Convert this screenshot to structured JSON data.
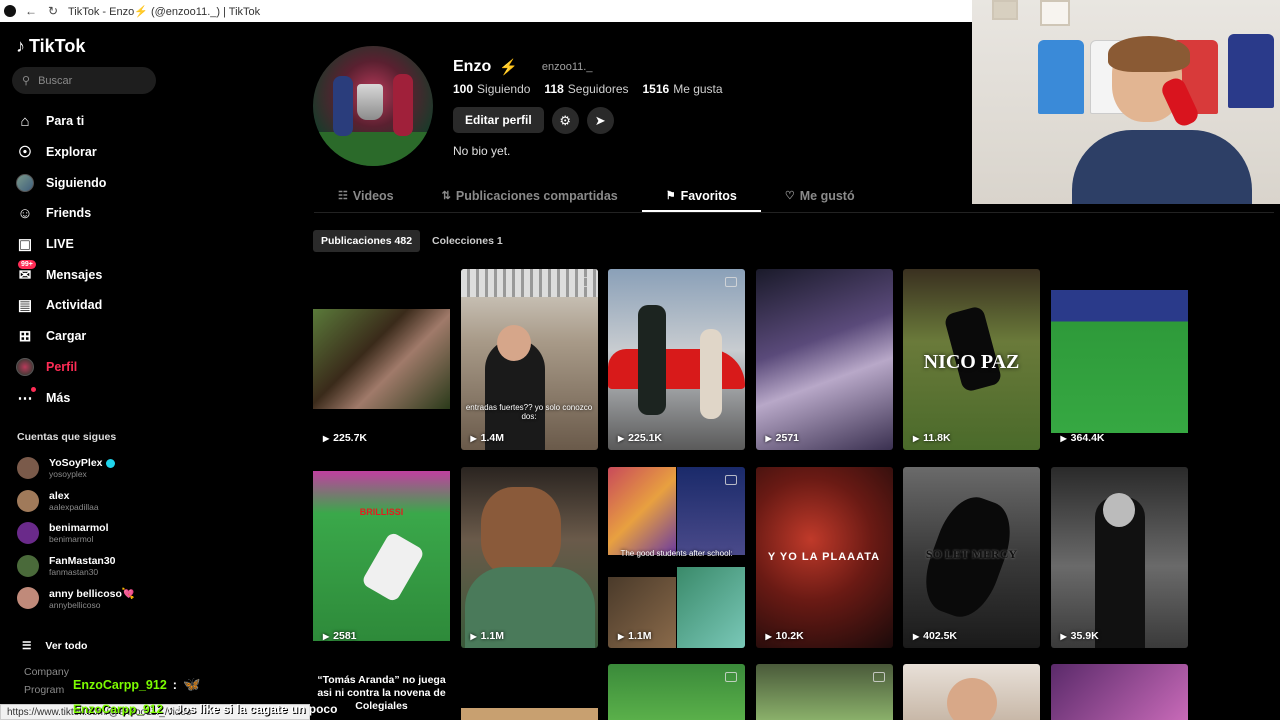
{
  "browser": {
    "title": "TikTok - Enzo⚡ (@enzoo11._) | TikTok",
    "status_url": "https://www.tiktok.com/@enzoo11._/video"
  },
  "sidebar": {
    "logo": "TikTok",
    "search_placeholder": "Buscar",
    "nav": [
      {
        "label": "Para ti",
        "icon": "home-icon"
      },
      {
        "label": "Explorar",
        "icon": "compass-icon"
      },
      {
        "label": "Siguiendo",
        "icon": "following-avatar"
      },
      {
        "label": "Friends",
        "icon": "friends-icon"
      },
      {
        "label": "LIVE",
        "icon": "live-icon"
      },
      {
        "label": "Mensajes",
        "icon": "messages-icon",
        "badge": "99+"
      },
      {
        "label": "Actividad",
        "icon": "activity-icon"
      },
      {
        "label": "Cargar",
        "icon": "upload-icon"
      },
      {
        "label": "Perfil",
        "icon": "profile-avatar"
      },
      {
        "label": "Más",
        "icon": "more-icon"
      }
    ],
    "following_title": "Cuentas que sigues",
    "following": [
      {
        "name": "YoSoyPlex",
        "user": "yosoyplex",
        "verified": true,
        "color": "#7a5a4a"
      },
      {
        "name": "alex",
        "user": "aalexpadillaa",
        "verified": false,
        "color": "#a07a5a"
      },
      {
        "name": "benimarmol",
        "user": "benimarmol",
        "verified": false,
        "color": "#6a2a8a"
      },
      {
        "name": "FanMastan30",
        "user": "fanmastan30",
        "verified": false,
        "color": "#4a6a3a"
      },
      {
        "name": "anny bellicoso💘",
        "user": "annybellicoso",
        "verified": false,
        "color": "#c08a7a"
      }
    ],
    "see_all": "Ver todo",
    "footer": [
      "Company",
      "Program"
    ]
  },
  "chat": {
    "line1_user": "EnzoCarpp_912",
    "line1_sep": ":",
    "line1_emoji": "🦋",
    "line2_user": "EnzoCarpp_912",
    "line2_msg": ": Jos like si la cagate un poco"
  },
  "profile": {
    "name": "Enzo",
    "username": "enzoo11._",
    "following_count": "100",
    "following_label": "Siguiendo",
    "followers_count": "118",
    "followers_label": "Seguidores",
    "likes_count": "1516",
    "likes_label": "Me gusta",
    "edit_label": "Editar perfil",
    "bio": "No bio yet."
  },
  "tabs": [
    {
      "label": "Videos",
      "icon": "☷",
      "active": false
    },
    {
      "label": "Publicaciones compartidas",
      "icon": "⇅",
      "active": false
    },
    {
      "label": "Favoritos",
      "icon": "⚑",
      "active": true
    },
    {
      "label": "Me gustó",
      "icon": "♡",
      "active": false
    }
  ],
  "subtabs": [
    {
      "label": "Publicaciones 482",
      "active": true
    },
    {
      "label": "Colecciones 1",
      "active": false
    }
  ],
  "videos": [
    {
      "views": "225.7K",
      "caption": ""
    },
    {
      "views": "1.4M",
      "caption": "entradas fuertes?? yo solo conozco dos:"
    },
    {
      "views": "225.1K",
      "caption": ""
    },
    {
      "views": "2571",
      "caption": ""
    },
    {
      "views": "11.8K",
      "caption": "NICO PAZ"
    },
    {
      "views": "364.4K",
      "caption": ""
    },
    {
      "views": "2581",
      "caption": "BRILLISSI"
    },
    {
      "views": "1.1M",
      "caption": ""
    },
    {
      "views": "1.1M",
      "caption": "The good students after school:"
    },
    {
      "views": "10.2K",
      "caption": "Y YO LA PLAAATA"
    },
    {
      "views": "402.5K",
      "caption": "SO LET MERCY"
    },
    {
      "views": "35.9K",
      "caption": ""
    }
  ],
  "row3": {
    "text_card": "“Tomás Aranda” no juega asi ni contra la novena de Colegiales"
  }
}
